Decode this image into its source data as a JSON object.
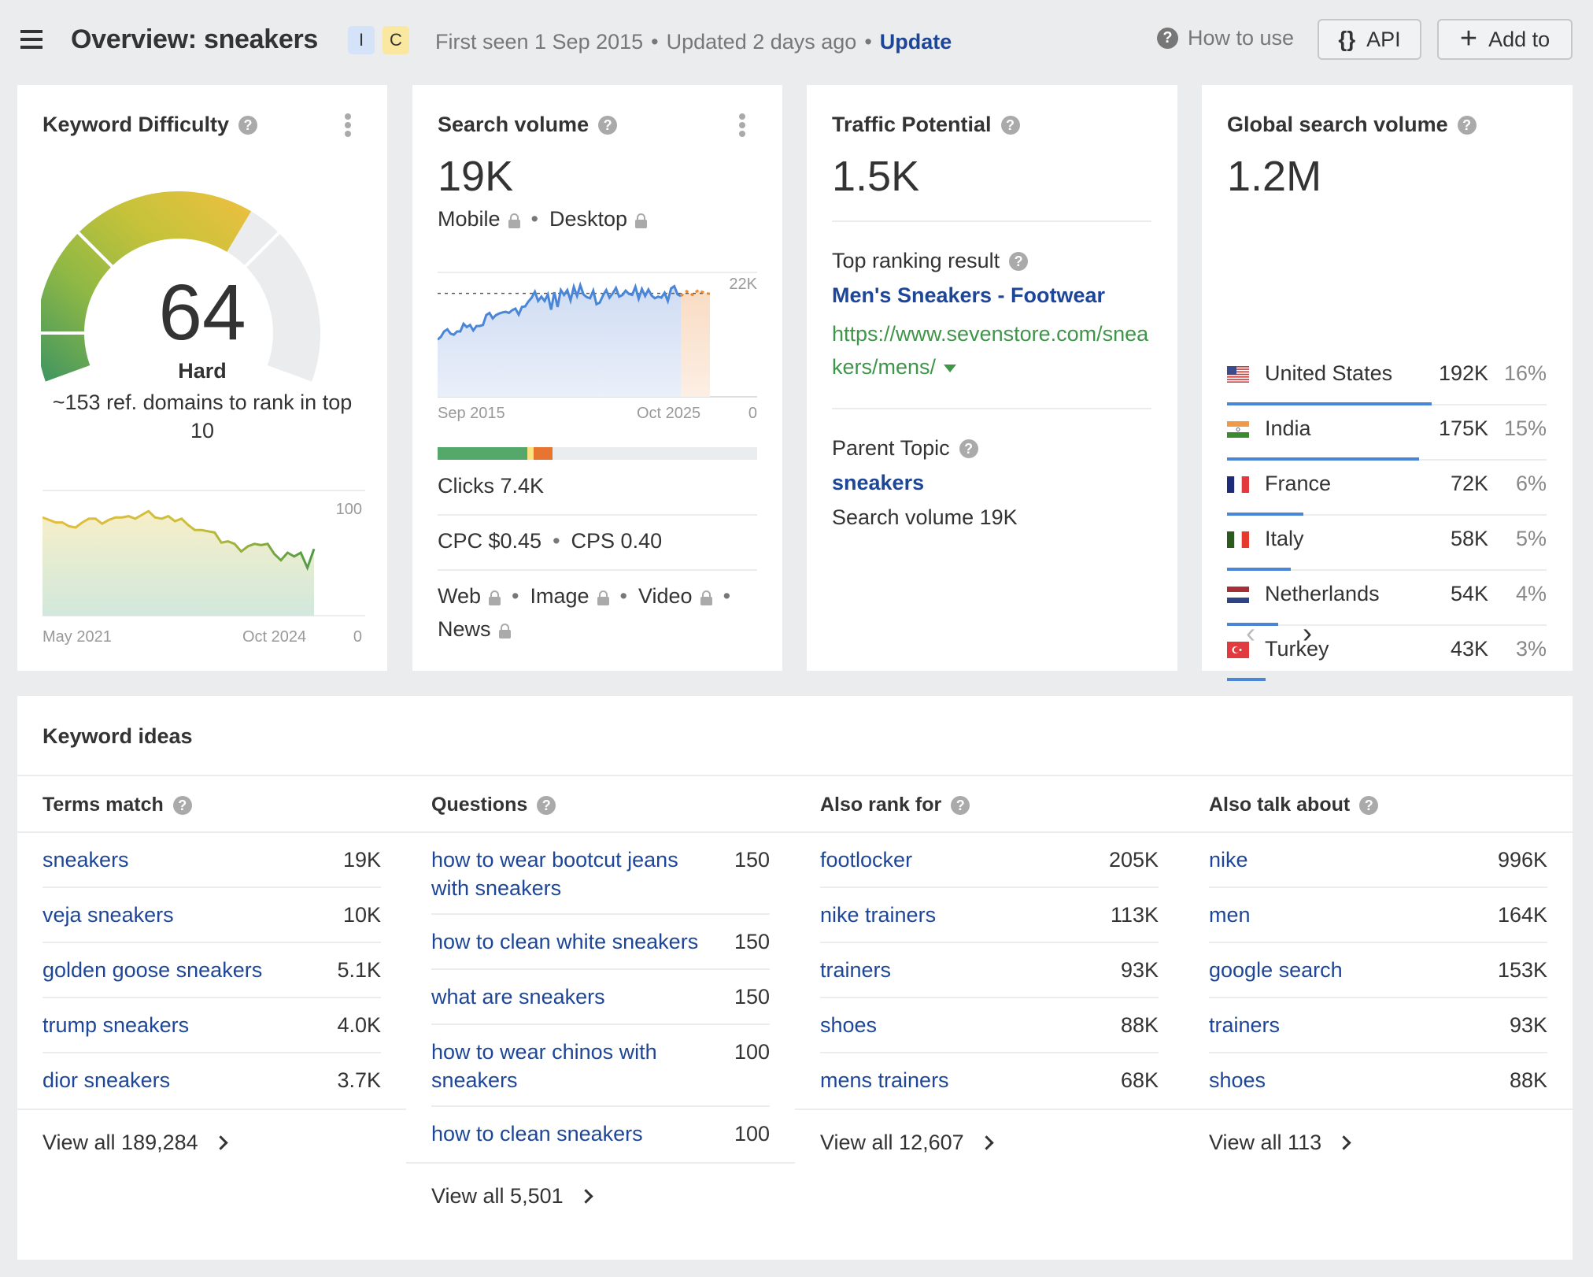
{
  "header": {
    "title": "Overview: sneakers",
    "intents": [
      "I",
      "C"
    ],
    "first_seen": "First seen 1 Sep 2015",
    "updated": "Updated 2 days ago",
    "update_link": "Update",
    "how_to_use": "How to use",
    "api_label": "API",
    "add_to_label": "Add to"
  },
  "keyword_difficulty": {
    "title": "Keyword Difficulty",
    "score": "64",
    "score_value": 64,
    "label": "Hard",
    "description": "~153 ref. domains to rank in top 10",
    "chart": {
      "start_label": "May 2021",
      "end_label": "Oct 2024",
      "y_max_label": "100",
      "y_min_label": "0",
      "values": [
        78,
        76,
        74,
        74,
        71,
        70,
        74,
        77,
        77,
        73,
        76,
        78,
        78,
        79,
        77,
        80,
        83,
        78,
        77,
        79,
        75,
        77,
        72,
        68,
        68,
        67,
        66,
        58,
        59,
        57,
        51,
        55,
        57,
        56,
        57,
        49,
        44,
        50,
        47,
        50,
        38,
        53
      ]
    }
  },
  "search_volume": {
    "title": "Search volume",
    "value": "19K",
    "devices": [
      "Mobile",
      "Desktop"
    ],
    "chart": {
      "start_label": "Sep 2015",
      "end_label": "Oct 2025",
      "y_max_label": "22K",
      "y_min_label": "0",
      "reference_line": 19,
      "values": [
        10.5,
        11,
        12,
        12.4,
        11.6,
        11.4,
        12,
        12,
        13.4,
        12.8,
        13.2,
        12.2,
        13,
        13,
        13.2,
        15,
        15.4,
        14.4,
        15,
        15.3,
        15.5,
        15.6,
        15.4,
        15.9,
        16.2,
        15.1,
        16.5,
        16.6,
        17.5,
        18.2,
        19.3,
        17.6,
        18.4,
        17.6,
        18.8,
        16,
        19.2,
        16.5,
        19.6,
        18.7,
        19.6,
        17.7,
        20.2,
        18.5,
        20.5,
        18.8,
        18.3,
        18.1,
        19.5,
        17,
        17.3,
        18.6,
        19.6,
        18.2,
        19,
        20,
        18.4,
        18.7,
        19.5,
        18.9,
        18.7,
        20.2,
        18,
        19.8,
        18.5,
        19.7,
        18.6,
        18.1,
        18.4,
        18.2,
        19.1,
        17.6,
        19.9,
        20.3,
        18.8,
        18.5
      ],
      "forecast": [
        18.5,
        19.4,
        18.7,
        19.6,
        19.1,
        18.9
      ]
    },
    "clicks_bar": [
      {
        "label": "organic",
        "percent": 28,
        "color": "#56a86a"
      },
      {
        "label": "mixed",
        "percent": 2,
        "color": "#fbe27f"
      },
      {
        "label": "paid",
        "percent": 6,
        "color": "#e77530"
      }
    ],
    "clicks": "Clicks 7.4K",
    "cpc": "CPC $0.45",
    "cps": "CPS 0.40",
    "serp_types": [
      "Web",
      "Image",
      "Video",
      "News"
    ]
  },
  "traffic_potential": {
    "title": "Traffic Potential",
    "value": "1.5K",
    "top_ranking_label": "Top ranking result",
    "top_result_title": "Men's Sneakers - Footwear",
    "top_result_url": "https://www.sevenstore.com/sneakers/mens/",
    "parent_topic_label": "Parent Topic",
    "parent_topic": "sneakers",
    "parent_topic_volume": "Search volume 19K"
  },
  "global_volume": {
    "title": "Global search volume",
    "value": "1.2M",
    "countries": [
      {
        "name": "United States",
        "volume": "192K",
        "percent": "16%",
        "share": 16,
        "flag": "us"
      },
      {
        "name": "India",
        "volume": "175K",
        "percent": "15%",
        "share": 15,
        "flag": "in"
      },
      {
        "name": "France",
        "volume": "72K",
        "percent": "6%",
        "share": 6,
        "flag": "fr"
      },
      {
        "name": "Italy",
        "volume": "58K",
        "percent": "5%",
        "share": 5,
        "flag": "it"
      },
      {
        "name": "Netherlands",
        "volume": "54K",
        "percent": "4%",
        "share": 4,
        "flag": "nl"
      },
      {
        "name": "Turkey",
        "volume": "43K",
        "percent": "3%",
        "share": 3,
        "flag": "tr"
      }
    ]
  },
  "keyword_ideas": {
    "title": "Keyword ideas",
    "columns": [
      {
        "heading": "Terms match",
        "rows": [
          {
            "keyword": "sneakers",
            "volume": "19K"
          },
          {
            "keyword": "veja sneakers",
            "volume": "10K"
          },
          {
            "keyword": "golden goose sneakers",
            "volume": "5.1K"
          },
          {
            "keyword": "trump sneakers",
            "volume": "4.0K"
          },
          {
            "keyword": "dior sneakers",
            "volume": "3.7K"
          }
        ],
        "view_all": "View all 189,284"
      },
      {
        "heading": "Questions",
        "rows": [
          {
            "keyword": "how to wear bootcut jeans with sneakers",
            "volume": "150"
          },
          {
            "keyword": "how to clean white sneakers",
            "volume": "150"
          },
          {
            "keyword": "what are sneakers",
            "volume": "150"
          },
          {
            "keyword": "how to wear chinos with sneakers",
            "volume": "100"
          },
          {
            "keyword": "how to clean sneakers",
            "volume": "100"
          }
        ],
        "view_all": "View all 5,501"
      },
      {
        "heading": "Also rank for",
        "rows": [
          {
            "keyword": "footlocker",
            "volume": "205K"
          },
          {
            "keyword": "nike trainers",
            "volume": "113K"
          },
          {
            "keyword": "trainers",
            "volume": "93K"
          },
          {
            "keyword": "shoes",
            "volume": "88K"
          },
          {
            "keyword": "mens trainers",
            "volume": "68K"
          }
        ],
        "view_all": "View all 12,607"
      },
      {
        "heading": "Also talk about",
        "rows": [
          {
            "keyword": "nike",
            "volume": "996K"
          },
          {
            "keyword": "men",
            "volume": "164K"
          },
          {
            "keyword": "google search",
            "volume": "153K"
          },
          {
            "keyword": "trainers",
            "volume": "93K"
          },
          {
            "keyword": "shoes",
            "volume": "88K"
          }
        ],
        "view_all": "View all 113"
      }
    ]
  }
}
